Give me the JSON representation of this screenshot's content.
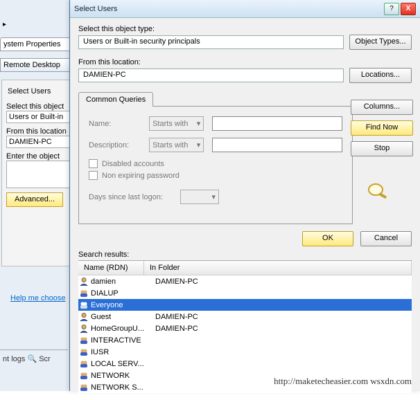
{
  "bg": {
    "arrow": "▸",
    "tab_sysprops": "ystem Properties",
    "tab_remote": "Remote Desktop",
    "panel": {
      "title": "Select Users",
      "obj_label": "Select this object",
      "obj_value": "Users or Built-in",
      "loc_label": "From this location",
      "loc_value": "DAMIEN-PC",
      "enter_label": "Enter the object",
      "advanced": "Advanced..."
    },
    "help": "Help me choose",
    "logs": "nt logs    🔍 Scr"
  },
  "dlg": {
    "title": "Select Users",
    "help_icon": "?",
    "close_icon": "X",
    "obj_label": "Select this object type:",
    "obj_value": "Users or Built-in security principals",
    "obj_btn": "Object Types...",
    "loc_label": "From this location:",
    "loc_value": "DAMIEN-PC",
    "loc_btn": "Locations...",
    "tab": "Common Queries",
    "query": {
      "name_label": "Name:",
      "name_mode": "Starts with",
      "desc_label": "Description:",
      "desc_mode": "Starts with",
      "chk_disabled": "Disabled accounts",
      "chk_nonexp": "Non expiring password",
      "days_label": "Days since last logon:",
      "tri": "▾"
    },
    "right": {
      "columns": "Columns...",
      "findnow": "Find Now",
      "stop": "Stop"
    },
    "ok": "OK",
    "cancel": "Cancel",
    "results_label": "Search results:",
    "cols": {
      "name": "Name (RDN)",
      "folder": "In Folder"
    },
    "rows": [
      {
        "icon": "user",
        "name": "damien",
        "folder": "DAMIEN-PC",
        "sel": false
      },
      {
        "icon": "group",
        "name": "DIALUP",
        "folder": "",
        "sel": false
      },
      {
        "icon": "group",
        "name": "Everyone",
        "folder": "",
        "sel": true
      },
      {
        "icon": "user",
        "name": "Guest",
        "folder": "DAMIEN-PC",
        "sel": false
      },
      {
        "icon": "user",
        "name": "HomeGroupU...",
        "folder": "DAMIEN-PC",
        "sel": false
      },
      {
        "icon": "group",
        "name": "INTERACTIVE",
        "folder": "",
        "sel": false
      },
      {
        "icon": "group",
        "name": "IUSR",
        "folder": "",
        "sel": false
      },
      {
        "icon": "group",
        "name": "LOCAL SERV...",
        "folder": "",
        "sel": false
      },
      {
        "icon": "group",
        "name": "NETWORK",
        "folder": "",
        "sel": false
      },
      {
        "icon": "group",
        "name": "NETWORK S...",
        "folder": "",
        "sel": false
      }
    ]
  },
  "watermark": "http://maketecheasier.com  wsxdn.com"
}
